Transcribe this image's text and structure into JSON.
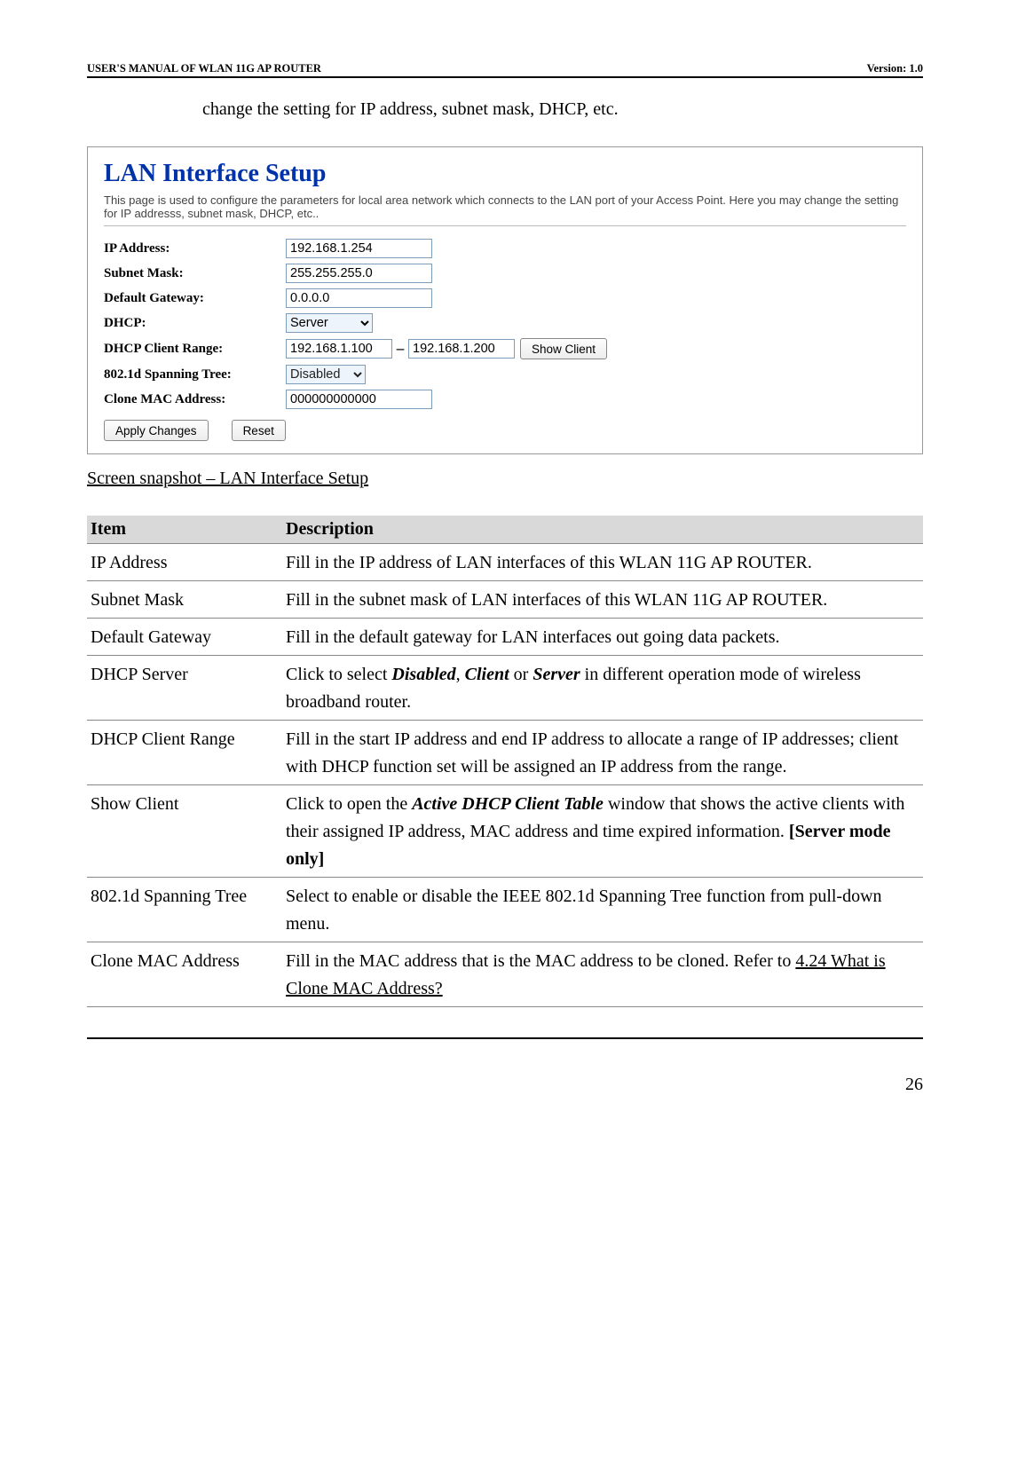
{
  "header": {
    "left": "USER'S MANUAL OF WLAN 11G AP ROUTER",
    "right": "Version: 1.0"
  },
  "intro": "change the setting for IP address, subnet mask, DHCP, etc.",
  "panel": {
    "title": "LAN Interface Setup",
    "desc": "This page is used to configure the parameters for local area network which connects to the LAN port of your Access Point. Here you may change the setting for IP addresss, subnet mask, DHCP, etc..",
    "ip_label": "IP Address:",
    "ip_value": "192.168.1.254",
    "mask_label": "Subnet Mask:",
    "mask_value": "255.255.255.0",
    "gw_label": "Default Gateway:",
    "gw_value": "0.0.0.0",
    "dhcp_label": "DHCP:",
    "dhcp_value": "Server",
    "range_label": "DHCP Client Range:",
    "range_start": "192.168.1.100",
    "range_end": "192.168.1.200",
    "show_client": "Show Client",
    "spt_label": "802.1d Spanning Tree:",
    "spt_value": "Disabled",
    "clone_label": "Clone MAC Address:",
    "clone_value": "000000000000",
    "apply": "Apply Changes",
    "reset": "Reset"
  },
  "caption": "Screen snapshot – LAN Interface Setup",
  "table": {
    "h1": "Item",
    "h2": "Description",
    "rows": [
      {
        "item": "IP Address",
        "parts": [
          {
            "t": "Fill in the IP address of LAN interfaces of this WLAN 11G AP ROUTER."
          }
        ]
      },
      {
        "item": "Subnet Mask",
        "parts": [
          {
            "t": "Fill in the subnet mask of LAN interfaces of this WLAN 11G AP ROUTER."
          }
        ]
      },
      {
        "item": "Default Gateway",
        "parts": [
          {
            "t": "Fill in the default gateway for LAN interfaces out going data packets."
          }
        ]
      },
      {
        "item": "DHCP Server",
        "parts": [
          {
            "t": "Click to select "
          },
          {
            "t": "Disabled",
            "cls": "bi"
          },
          {
            "t": ", "
          },
          {
            "t": "Client",
            "cls": "bi"
          },
          {
            "t": " or "
          },
          {
            "t": "Server",
            "cls": "bi"
          },
          {
            "t": " in different operation mode of wireless broadband router."
          }
        ]
      },
      {
        "item": "DHCP Client Range",
        "parts": [
          {
            "t": "Fill in the start IP address and end IP address to allocate a range of IP addresses; client with DHCP function set will be assigned an IP address from the range."
          }
        ]
      },
      {
        "item": "Show Client",
        "parts": [
          {
            "t": "Click to open the "
          },
          {
            "t": "Active DHCP Client Table",
            "cls": "bi"
          },
          {
            "t": " window that shows the active clients with their assigned IP address, MAC address and time expired information. "
          },
          {
            "t": "[Server mode only]",
            "cls": "b"
          }
        ]
      },
      {
        "item": "802.1d Spanning Tree",
        "parts": [
          {
            "t": "Select to enable or disable the IEEE 802.1d Spanning Tree function from pull-down menu."
          }
        ]
      },
      {
        "item": "Clone MAC Address",
        "parts": [
          {
            "t": "Fill in the MAC address that is the MAC address to be cloned. Refer to "
          },
          {
            "t": "4.24 What is Clone MAC Address?",
            "cls": "u"
          }
        ]
      }
    ]
  },
  "page_number": "26"
}
